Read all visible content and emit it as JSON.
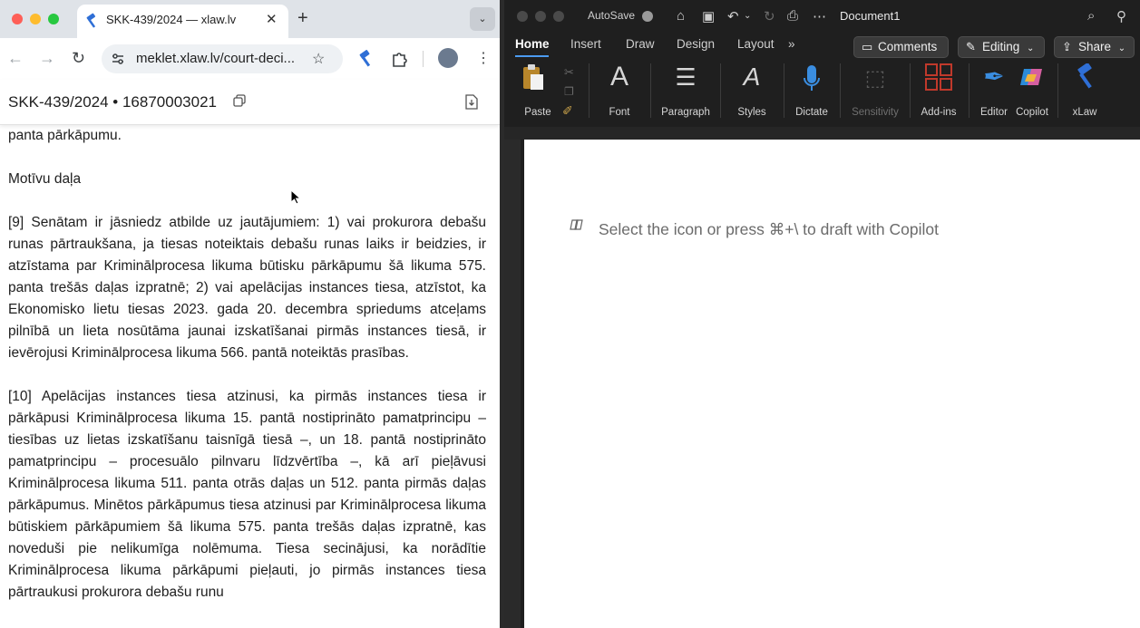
{
  "browser": {
    "tab": {
      "title": "SKK-439/2024 — xlaw.lv",
      "close_glyph": "✕"
    },
    "new_tab_glyph": "+",
    "tab_menu_glyph": "⌄",
    "address": {
      "url": "meklet.xlaw.lv/court-deci..."
    },
    "page_header": {
      "title": "SKK-439/2024 • 16870003021"
    },
    "content": {
      "lead_line": "panta pārkāpumu.",
      "section_heading": "Motīvu daļa",
      "paragraphs": [
        "[9] Senātam ir jāsniedz atbilde uz jautājumiem: 1) vai prokurora debašu runas pārtraukšana, ja tiesas noteiktais debašu runas laiks ir beidzies, ir atzīstama par Kriminālprocesa likuma būtisku pārkāpumu šā likuma 575. panta trešās daļas izpratnē; 2) vai apelācijas instances tiesa, atzīstot, ka Ekonomisko lietu tiesas 2023. gada 20. decembra spriedums atceļams pilnībā un lieta nosūtāma jaunai izskatīšanai pirmās instances tiesā, ir ievērojusi Kriminālprocesa likuma 566. pantā noteiktās prasības.",
        "[10] Apelācijas instances tiesa atzinusi, ka pirmās instances tiesa ir pārkāpusi Kriminālprocesa likuma 15. pantā nostiprināto pamatprincipu – tiesības uz lietas izskatīšanu taisnīgā tiesā –, un 18. pantā nostiprināto pamatprincipu – procesuālo pilnvaru līdzvērtība –, kā arī pieļāvusi Kriminālprocesa likuma 511. panta otrās daļas un 512. panta pirmās daļas pārkāpumus. Minētos pārkāpumus tiesa atzinusi par Kriminālprocesa likuma būtiskiem pārkāpumiem šā likuma 575. panta trešās daļas izpratnē, kas noveduši pie nelikumīga nolēmuma. Tiesa secinājusi, ka norādītie Kriminālprocesa likuma pārkāpumi pieļauti, jo pirmās instances tiesa pārtraukusi prokurora debašu runu"
      ]
    },
    "icons": [
      "xlaw-favicon",
      "back-icon",
      "forward-icon",
      "reload-icon",
      "site-info-icon",
      "bookmark-star-icon",
      "xlaw-extension-icon",
      "extensions-puzzle-icon",
      "profile-avatar",
      "menu-kebab-icon",
      "copy-icon",
      "pdf-download-icon"
    ]
  },
  "word": {
    "autosave_label": "AutoSave",
    "document_name": "Document1",
    "ribbon_tabs": [
      "Home",
      "Insert",
      "Draw",
      "Design",
      "Layout"
    ],
    "more_tabs_glyph": "»",
    "buttons": {
      "comments": "Comments",
      "editing": "Editing",
      "share": "Share"
    },
    "ribbon_groups": {
      "paste": "Paste",
      "font": "Font",
      "paragraph": "Paragraph",
      "styles": "Styles",
      "dictate": "Dictate",
      "sensitivity": "Sensitivity",
      "addins": "Add-ins",
      "editor": "Editor",
      "copilot": "Copilot",
      "xlaw": "xLaw"
    },
    "copilot_hint": "Select the icon or press ⌘+\\ to draft with Copilot"
  },
  "colors": {
    "accent_blue": "#4c9bf0",
    "xlaw_blue": "#2f6fd6",
    "word_bg": "#1f1f1f"
  }
}
